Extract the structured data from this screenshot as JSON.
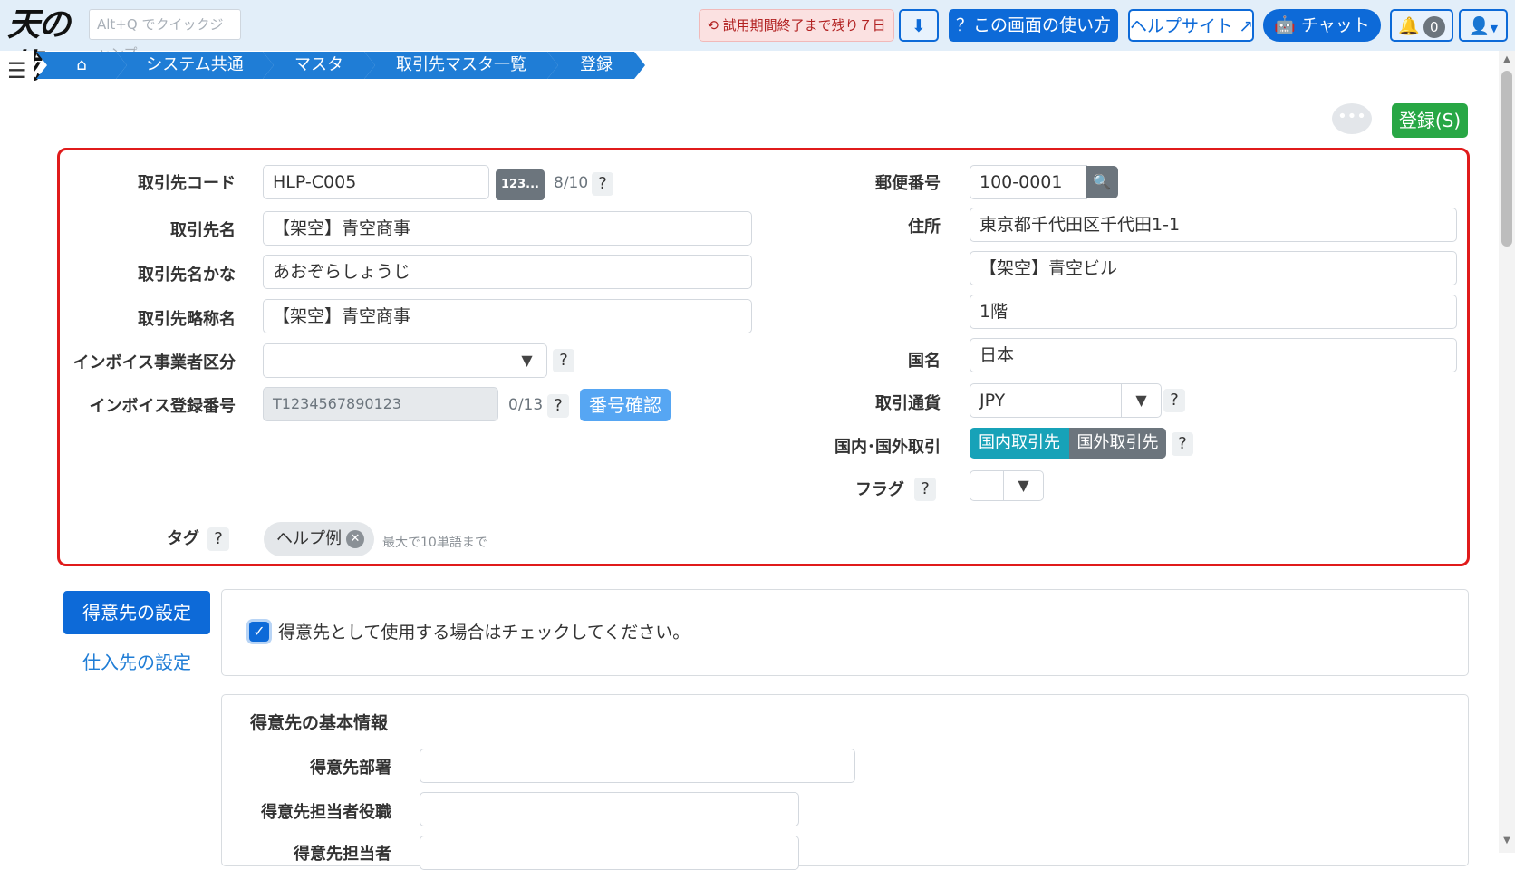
{
  "header": {
    "logo": "天の蔵",
    "jump_placeholder": "Alt+Q でクイックジャンプ",
    "trial": "試用期間終了まで残り７日",
    "howto": "？この画面の使い方",
    "helpsite": "ヘルプサイト",
    "chat": "チャット",
    "notifications": "0",
    "icons": [
      "download-icon",
      "external-link-icon",
      "robot-icon",
      "bell-icon",
      "user-icon"
    ]
  },
  "breadcrumb": [
    "システム共通",
    "マスタ",
    "取引先マスタ一覧",
    "登録"
  ],
  "actions": {
    "register": "登録(S)"
  },
  "form": {
    "code": {
      "label": "取引先コード",
      "value": "HLP-C005",
      "seq_button": "123...",
      "count": "8/10"
    },
    "name": {
      "label": "取引先名",
      "value": "【架空】青空商事"
    },
    "kana": {
      "label": "取引先名かな",
      "value": "あおぞらしょうじ"
    },
    "short_name": {
      "label": "取引先略称名",
      "value": "【架空】青空商事"
    },
    "invoice_type": {
      "label": "インボイス事業者区分",
      "value": ""
    },
    "invoice_no": {
      "label": "インボイス登録番号",
      "placeholder": "T1234567890123",
      "count": "0/13",
      "verify_button": "番号確認"
    },
    "tag": {
      "label": "タグ",
      "chip": "ヘルプ例",
      "hint": "最大で10単語まで"
    },
    "zip": {
      "label": "郵便番号",
      "value": "100-0001"
    },
    "address": {
      "label": "住所",
      "line1": "東京都千代田区千代田1-1",
      "line2": "【架空】青空ビル",
      "line3": "1階"
    },
    "country": {
      "label": "国名",
      "value": "日本"
    },
    "currency": {
      "label": "取引通貨",
      "value": "JPY"
    },
    "domestic": {
      "label": "国内･国外取引",
      "option_domestic": "国内取引先",
      "option_foreign": "国外取引先",
      "selected": "国内取引先"
    },
    "flag": {
      "label": "フラグ",
      "value": ""
    }
  },
  "side_tabs": {
    "customer": "得意先の設定",
    "supplier": "仕入先の設定"
  },
  "customer": {
    "use_as_customer": "得意先として使用する場合はチェックしてください。",
    "checked": true,
    "basic_title": "得意先の基本情報",
    "department_label": "得意先部署",
    "position_label": "得意先担当者役職",
    "person_label": "得意先担当者"
  }
}
